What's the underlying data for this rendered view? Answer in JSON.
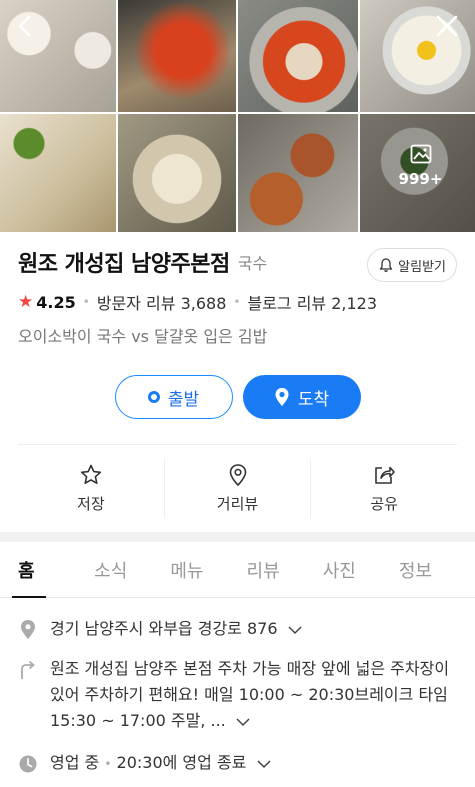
{
  "photos": {
    "more_count": "999+",
    "items": [
      "dumplings-table",
      "noodle-soup-tv",
      "red-noodle-bowl",
      "kalguksu-bowl",
      "noodle-closeup",
      "dumpling-tv",
      "mung-bean-pancakes",
      "side-dishes"
    ]
  },
  "header": {
    "title": "원조 개성집 남양주본점",
    "category": "국수",
    "alarm_label": "알림받기"
  },
  "stats": {
    "rating": "4.25",
    "visitor_reviews": "방문자 리뷰 3,688",
    "blog_reviews": "블로그 리뷰 2,123"
  },
  "description": "오이소박이 국수 vs 달걀옷 입은 김밥",
  "route": {
    "start_label": "출발",
    "arrive_label": "도착"
  },
  "actions": [
    {
      "label": "저장",
      "icon": "star-outline-icon"
    },
    {
      "label": "거리뷰",
      "icon": "location-pin-icon"
    },
    {
      "label": "공유",
      "icon": "share-icon"
    }
  ],
  "tabs": [
    "홈",
    "소식",
    "메뉴",
    "리뷰",
    "사진",
    "정보"
  ],
  "active_tab": "홈",
  "details": {
    "address": "경기 남양주시 와부읍 경강로 876",
    "parking": "원조 개성집 남양주 본점 주차 가능 매장 앞에 넓은 주차장이 있어 주차하기 편해요! 매일 10:00 ~ 20:30브레이크 타임 15:30 ~ 17:00 주말, ...",
    "hours_status": "영업 중",
    "hours_detail": "20:30에 영업 종료"
  },
  "colors": {
    "accent": "#1a7cf5",
    "star": "#f2473f"
  }
}
